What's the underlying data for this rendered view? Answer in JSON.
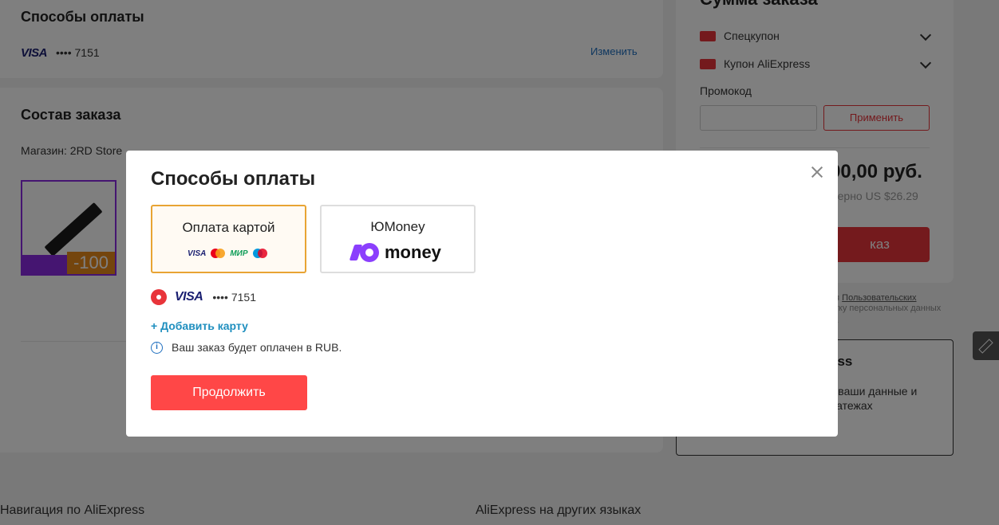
{
  "background": {
    "payment_section": {
      "title": "Способы оплаты",
      "card_brand": "VISA",
      "card_masked": "•••• 7151",
      "change_link": "Изменить"
    },
    "order_section": {
      "title": "Состав заказа",
      "shop": "Магазин: 2RD Store",
      "discount_badge": "-100"
    },
    "summary": {
      "title": "Сумма заказа",
      "coupons": [
        {
          "label": "Спецкупон"
        },
        {
          "label": "Купон AliExpress"
        }
      ],
      "promo_label": "Промокод",
      "apply_button": "Применить",
      "total_price": "90,00 руб.",
      "total_usd": "мерно US $26.29",
      "order_button": "каз",
      "terms_line1": "ия ",
      "terms_link1": "Пользовательских",
      "terms_line2": "отку персональных данных",
      "terms_link2": "ги",
      "secure_title": "ess",
      "secure_text": "т ваши данные и латежах"
    },
    "footer": {
      "nav": "Навигация по AliExpress",
      "languages": "AliExpress на других языках"
    }
  },
  "modal": {
    "title": "Способы оплаты",
    "methods": [
      {
        "label": "Оплата картой",
        "selected": true,
        "logos": [
          "VISA",
          "mastercard",
          "МИР",
          "maestro"
        ]
      },
      {
        "label": "ЮMoney",
        "selected": false,
        "logo_text": "money"
      }
    ],
    "saved_card": {
      "brand": "VISA",
      "masked": "•••• 7151",
      "selected": true
    },
    "add_card": "+ Добавить карту",
    "info_icon_glyph": "i",
    "note": "Ваш заказ будет оплачен в RUB.",
    "continue_button": "Продолжить"
  },
  "colors": {
    "accent_red": "#ff4747",
    "selected_border": "#e8a433",
    "link_blue": "#1f8fbf",
    "yoomoney_purple": "#8b3ffd"
  }
}
